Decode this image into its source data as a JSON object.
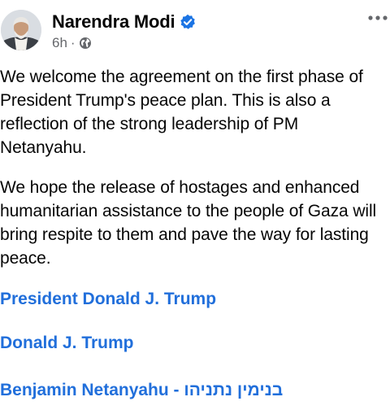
{
  "post": {
    "author": "Narendra Modi",
    "timestamp": "6h",
    "separator": "·",
    "audience_icon": "globe-icon",
    "verified_icon": "verified-badge-icon",
    "more_icon": "more-options-icon",
    "paragraphs": [
      "We welcome the agreement on the first phase of\nPresident Trump's peace plan. This is also a\nreflection of the strong leadership of PM\nNetanyahu.",
      "We hope the release of hostages and enhanced\nhumanitarian assistance to the people of Gaza will\nbring respite to them and pave the way for lasting\npeace."
    ],
    "tags": [
      "President Donald J. Trump",
      "Donald J. Trump",
      "Benjamin Netanyahu - בנימין נתניהו"
    ]
  },
  "colors": {
    "link": "#216fdb",
    "verified": "#1b74e4",
    "meta": "#65676b",
    "text": "#050505"
  }
}
